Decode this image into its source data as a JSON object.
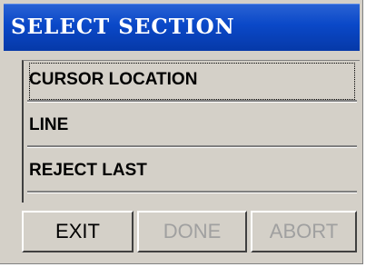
{
  "window": {
    "title": "SELECT SECTION"
  },
  "list": {
    "items": [
      "CURSOR LOCATION",
      "LINE",
      "REJECT LAST"
    ],
    "selected_index": 0
  },
  "buttons": {
    "exit": "EXIT",
    "done": "DONE",
    "abort": "ABORT"
  },
  "colors": {
    "titlebar": "#0a48c8",
    "face": "#d4d0c8",
    "disabled_text": "#a0a0a0"
  }
}
